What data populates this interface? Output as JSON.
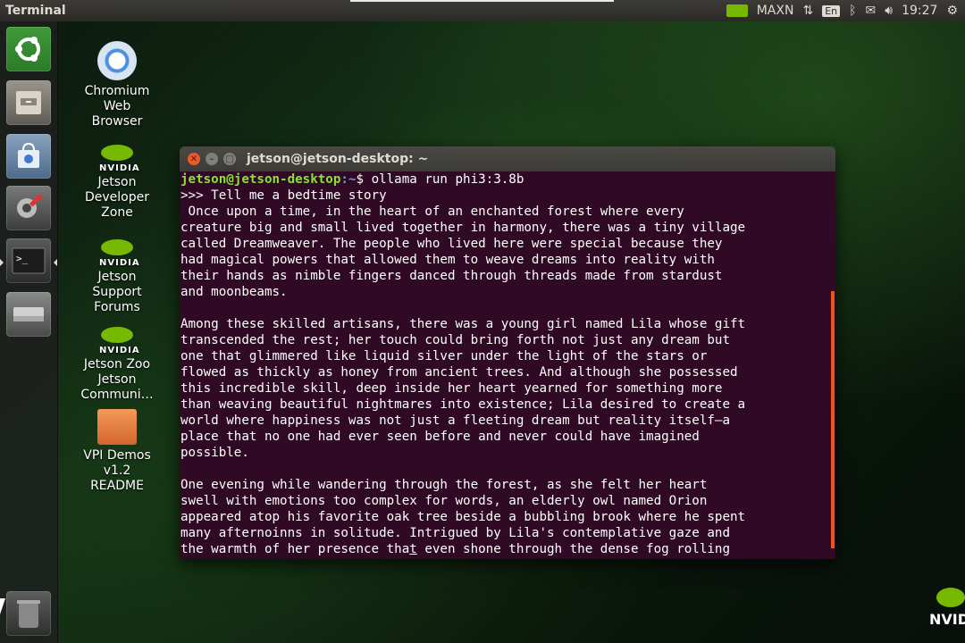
{
  "panel": {
    "app_title": "Terminal",
    "power_mode": "MAXN",
    "keyboard_lang": "En",
    "clock": "19:27"
  },
  "launcher": {
    "items": [
      "Ubuntu Dash",
      "Files",
      "Ubuntu Software",
      "System Settings",
      "Terminal",
      "Drive",
      "Trash"
    ]
  },
  "desktop": {
    "icons": [
      {
        "label": "Chromium Web Browser"
      },
      {
        "label": "Jetson Developer Zone"
      },
      {
        "label": "Jetson Support Forums"
      },
      {
        "label": "Jetson Zoo"
      },
      {
        "label": "Jetson Communi…"
      },
      {
        "label": "VPI Demos v1.2"
      },
      {
        "label": "README"
      }
    ],
    "corner_logo_text": "NVIDI"
  },
  "terminal": {
    "title": "jetson@jetson-desktop: ~",
    "prompt_user": "jetson@jetson-desktop",
    "prompt_path": ":~",
    "prompt_symbol": "$ ",
    "command": "ollama run phi3:3.8b",
    "lines": [
      ">>> Tell me a bedtime story",
      " Once upon a time, in the heart of an enchanted forest where every",
      "creature big and small lived together in harmony, there was a tiny village",
      "called Dreamweaver. The people who lived here were special because they",
      "had magical powers that allowed them to weave dreams into reality with",
      "their hands as nimble fingers danced through threads made from stardust",
      "and moonbeams.",
      "",
      "Among these skilled artisans, there was a young girl named Lila whose gift",
      "transcended the rest; her touch could bring forth not just any dream but",
      "one that glimmered like liquid silver under the light of the stars or",
      "flowed as thickly as honey from ancient trees. And although she possessed",
      "this incredible skill, deep inside her heart yearned for something more",
      "than weaving beautiful nightmares into existence; Lila desired to create a",
      "world where happiness was not just a fleeting dream but reality itself—a",
      "place that no one had ever seen before and never could have imagined",
      "possible.",
      "",
      "One evening while wandering through the forest, as she felt her heart",
      "swell with emotions too complex for words, an elderly owl named Orion",
      "appeared atop his favorite oak tree beside a bubbling brook where he spent",
      "many afternoinns in solitude. Intrigued by Lila's contemplative gaze and"
    ],
    "last_line_before": "the warmth of her presence tha",
    "last_line_cursor": "t",
    "last_line_after": " even shone through the dense fog rolling"
  }
}
